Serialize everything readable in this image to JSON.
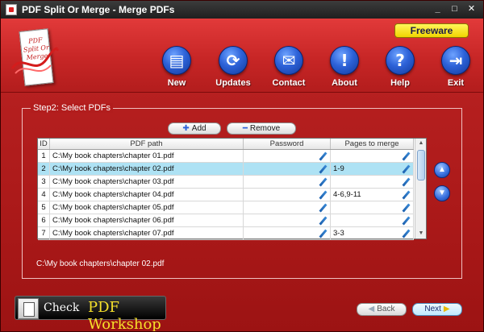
{
  "window": {
    "title": "PDF Split Or Merge - Merge PDFs"
  },
  "titlebar": {
    "minimize": "_",
    "maximize": "□",
    "close": "✕"
  },
  "logo": {
    "text": "PDF Split Or Merge"
  },
  "freeware_badge": "Freeware",
  "toolbar": [
    {
      "label": "New",
      "icon": "document-icon",
      "glyph": "▤"
    },
    {
      "label": "Updates",
      "icon": "refresh-icon",
      "glyph": "⟳"
    },
    {
      "label": "Contact",
      "icon": "envelope-icon",
      "glyph": "✉"
    },
    {
      "label": "About",
      "icon": "info-icon",
      "glyph": "!"
    },
    {
      "label": "Help",
      "icon": "help-icon",
      "glyph": "?"
    },
    {
      "label": "Exit",
      "icon": "exit-door-icon",
      "glyph": "⇥"
    }
  ],
  "step": {
    "legend": "Step2: Select PDFs"
  },
  "actions": {
    "add_label": "Add",
    "remove_label": "Remove"
  },
  "table": {
    "headers": {
      "id": "ID",
      "path": "PDF path",
      "password": "Password",
      "pages": "Pages to merge"
    },
    "rows": [
      {
        "id": "1",
        "path": "C:\\My book chapters\\chapter 01.pdf",
        "password": "",
        "pages": ""
      },
      {
        "id": "2",
        "path": "C:\\My book chapters\\chapter 02.pdf",
        "password": "",
        "pages": "1-9"
      },
      {
        "id": "3",
        "path": "C:\\My book chapters\\chapter 03.pdf",
        "password": "",
        "pages": ""
      },
      {
        "id": "4",
        "path": "C:\\My book chapters\\chapter 04.pdf",
        "password": "",
        "pages": "4-6,9-11"
      },
      {
        "id": "5",
        "path": "C:\\My book chapters\\chapter 05.pdf",
        "password": "",
        "pages": ""
      },
      {
        "id": "6",
        "path": "C:\\My book chapters\\chapter 06.pdf",
        "password": "",
        "pages": ""
      },
      {
        "id": "7",
        "path": "C:\\My book chapters\\chapter 07.pdf",
        "password": "",
        "pages": "3-3"
      }
    ],
    "selected_index": 1
  },
  "selected_path": "C:\\My book chapters\\chapter 02.pdf",
  "workshop": {
    "check": "Check",
    "name": "PDF Workshop"
  },
  "nav": {
    "back_label": "Back",
    "next_label": "Next"
  },
  "colors": {
    "background": "#b21d1d",
    "selection": "#aee2f4",
    "accent": "#2d62d8",
    "badge": "#f1d500"
  }
}
